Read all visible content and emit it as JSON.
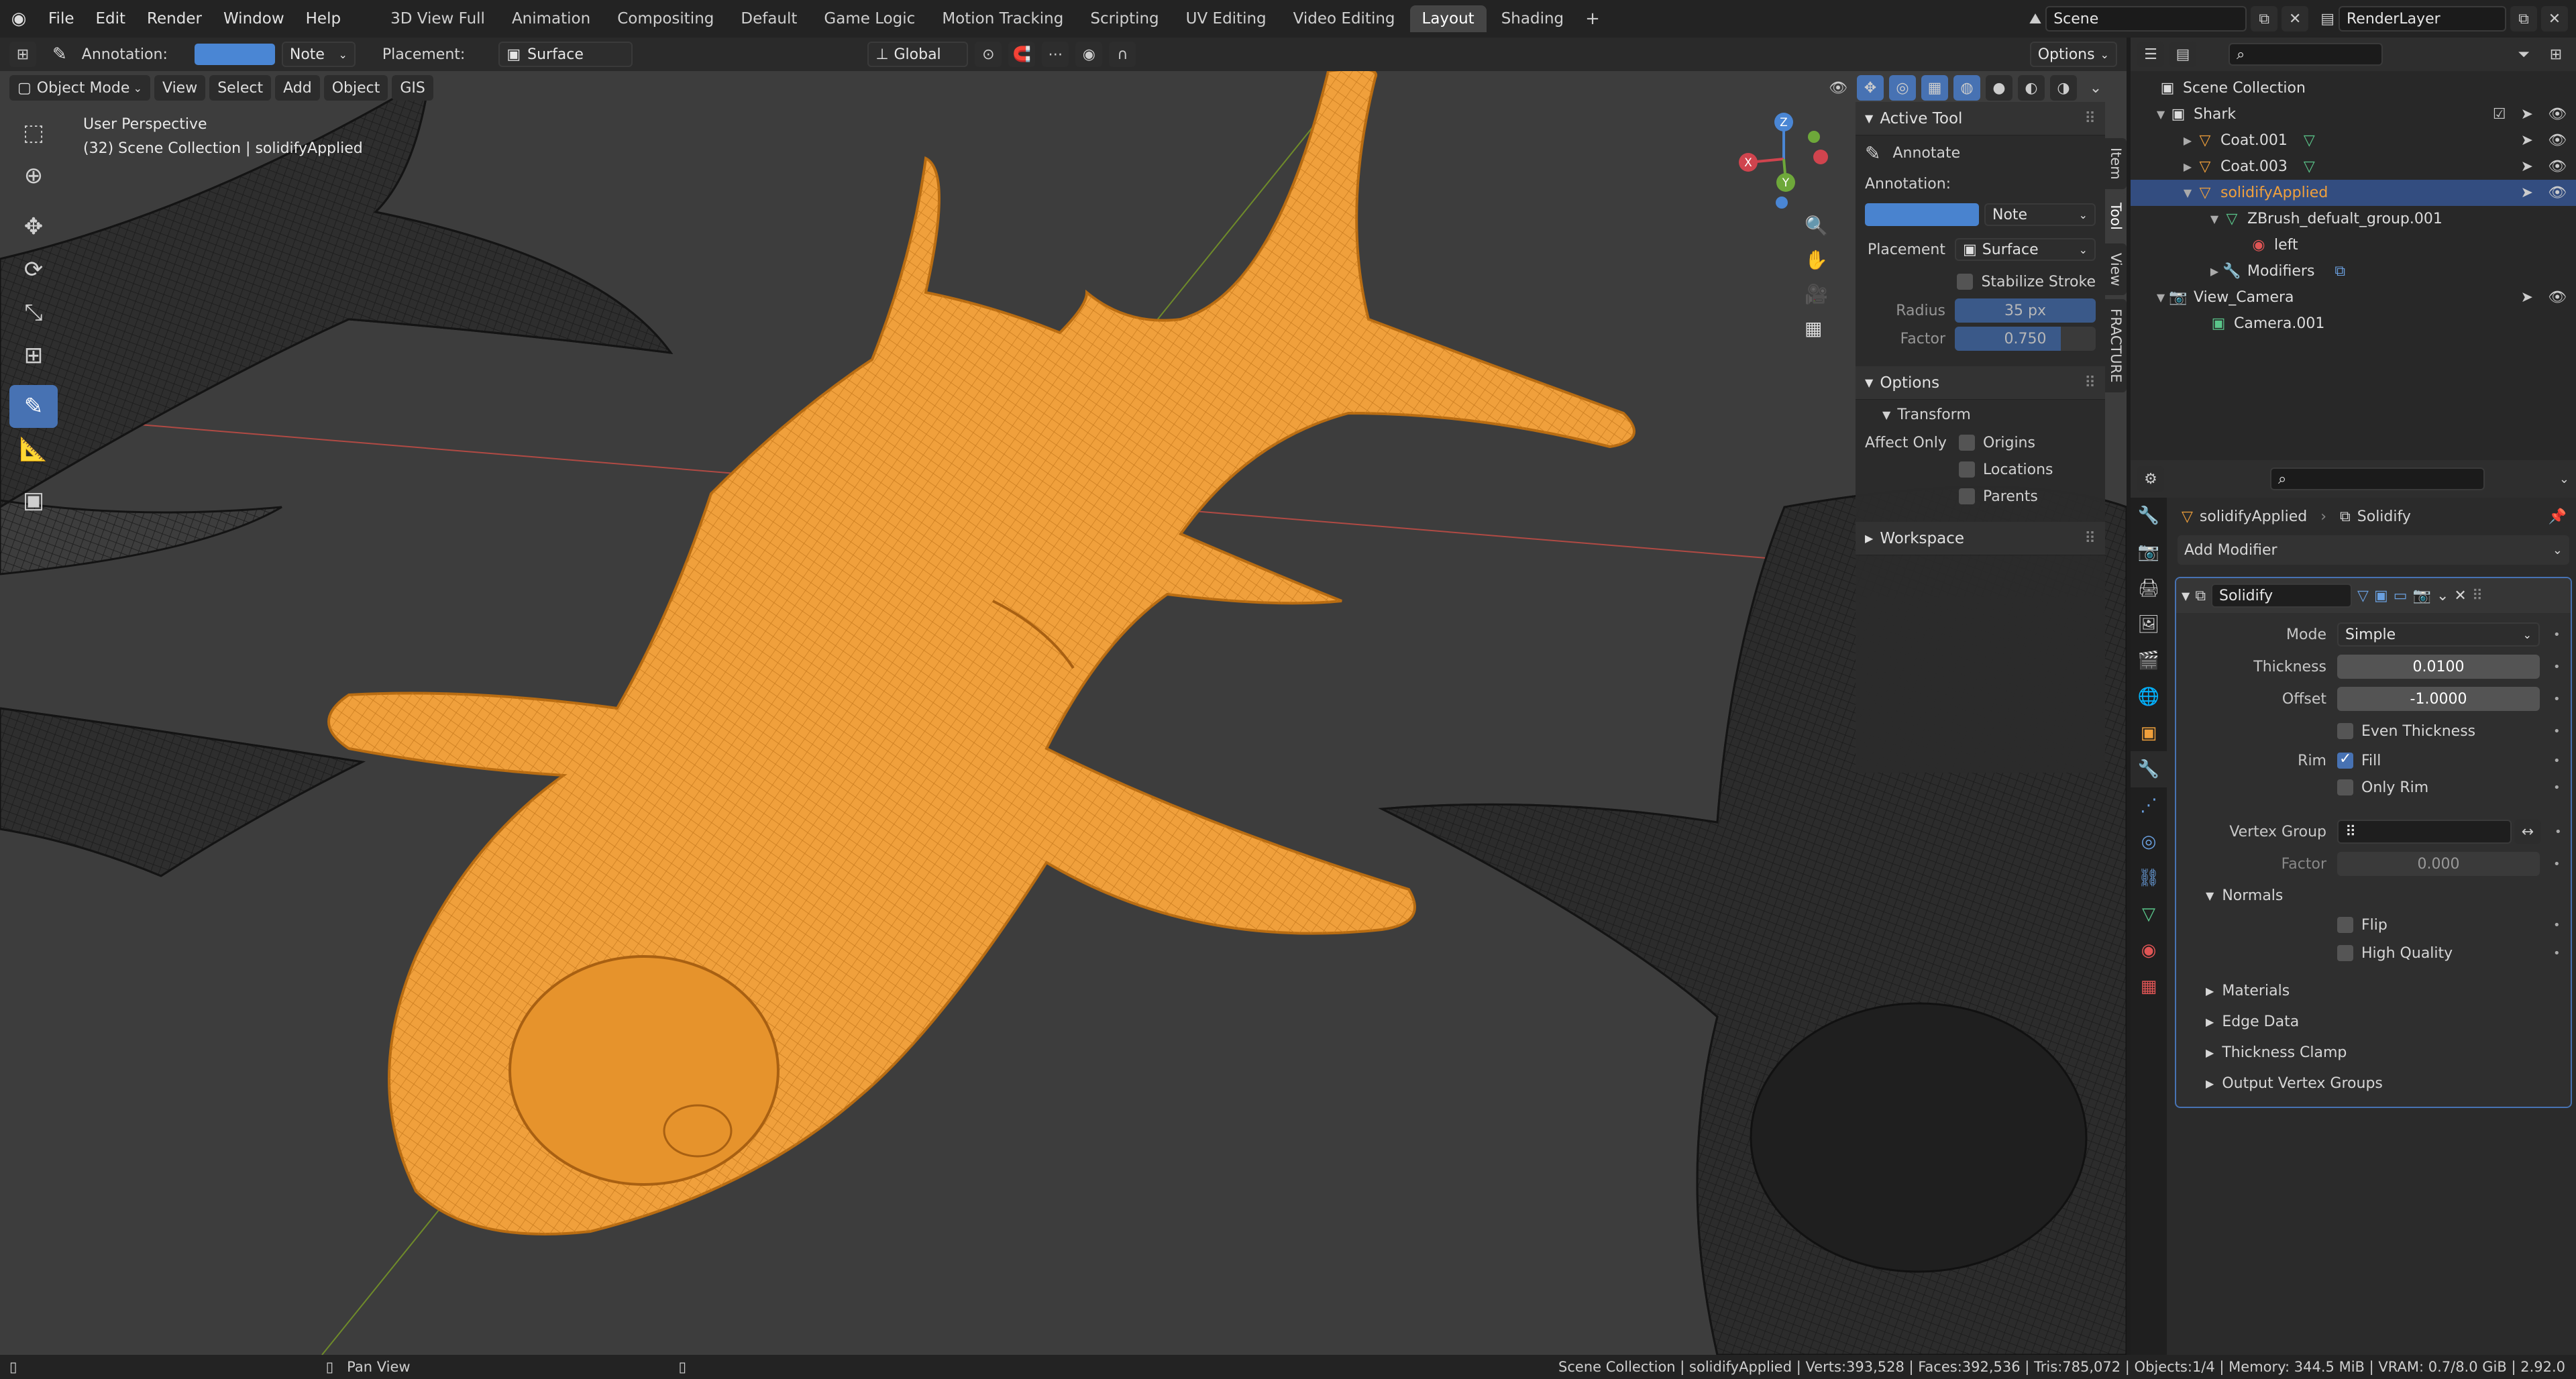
{
  "topbar": {
    "menus": [
      "File",
      "Edit",
      "Render",
      "Window",
      "Help"
    ],
    "workspaces": [
      "3D View Full",
      "Animation",
      "Compositing",
      "Default",
      "Game Logic",
      "Motion Tracking",
      "Scripting",
      "UV Editing",
      "Video Editing",
      "Layout",
      "Shading"
    ],
    "active_workspace": "Layout",
    "scene": "Scene",
    "render_layer": "RenderLayer"
  },
  "tool_header": {
    "annotation_label": "Annotation:",
    "note": "Note",
    "placement_label": "Placement:",
    "placement": "Surface",
    "orientation": "Global",
    "options": "Options"
  },
  "viewport_header": {
    "mode": "Object Mode",
    "menus": [
      "View",
      "Select",
      "Add",
      "Object",
      "GIS"
    ]
  },
  "viewport": {
    "perspective": "User Perspective",
    "collection_info": "(32) Scene Collection | solidifyApplied",
    "gizmo_axes": [
      "X",
      "Y",
      "Z"
    ]
  },
  "npanel": {
    "active_tool_title": "Active Tool",
    "tool_name": "Annotate",
    "annotation_label": "Annotation:",
    "note": "Note",
    "placement_label": "Placement",
    "placement": "Surface",
    "stabilize": "Stabilize Stroke",
    "radius_label": "Radius",
    "radius_value": "35 px",
    "factor_label": "Factor",
    "factor_value": "0.750",
    "options_title": "Options",
    "transform_title": "Transform",
    "affect_only": "Affect Only",
    "affect_items": [
      "Origins",
      "Locations",
      "Parents"
    ],
    "workspace_title": "Workspace",
    "tabs": [
      "Item",
      "Tool",
      "View",
      "FRACTURE"
    ],
    "active_tab": "Tool"
  },
  "outliner": {
    "rows": [
      {
        "label": "Scene Collection",
        "indent": 0
      },
      {
        "label": "Shark",
        "indent": 1
      },
      {
        "label": "Coat.001",
        "indent": 2
      },
      {
        "label": "Coat.003",
        "indent": 2
      },
      {
        "label": "solidifyApplied",
        "indent": 2
      },
      {
        "label": "ZBrush_defualt_group.001",
        "indent": 3
      },
      {
        "label": "left",
        "indent": 4
      },
      {
        "label": "Modifiers",
        "indent": 3
      },
      {
        "label": "View_Camera",
        "indent": 1
      },
      {
        "label": "Camera.001",
        "indent": 2
      }
    ]
  },
  "properties": {
    "object_name": "solidifyApplied",
    "modifier_name_crumb": "Solidify",
    "add_modifier": "Add Modifier",
    "modifier_name": "Solidify",
    "mode_label": "Mode",
    "mode_value": "Simple",
    "thickness_label": "Thickness",
    "thickness_value": "0.0100",
    "offset_label": "Offset",
    "offset_value": "-1.0000",
    "even_thickness": "Even Thickness",
    "rim_label": "Rim",
    "fill": "Fill",
    "only_rim": "Only Rim",
    "vertex_group_label": "Vertex Group",
    "factor_label": "Factor",
    "factor_value": "0.000",
    "normals_title": "Normals",
    "flip": "Flip",
    "high_quality": "High Quality",
    "subpanels": [
      "Materials",
      "Edge Data",
      "Thickness Clamp",
      "Output Vertex Groups"
    ]
  },
  "statusbar": {
    "pan_view": "Pan View",
    "stats": "Scene Collection | solidifyApplied | Verts:393,528 | Faces:392,536 | Tris:785,072 | Objects:1/4 | Memory: 344.5 MiB | VRAM: 0.7/8.0 GiB | 2.92.0"
  },
  "colors": {
    "selected_orange": "#f0a03c",
    "accent_blue": "#4772b3",
    "viewport_bg": "#3d3d3d"
  }
}
